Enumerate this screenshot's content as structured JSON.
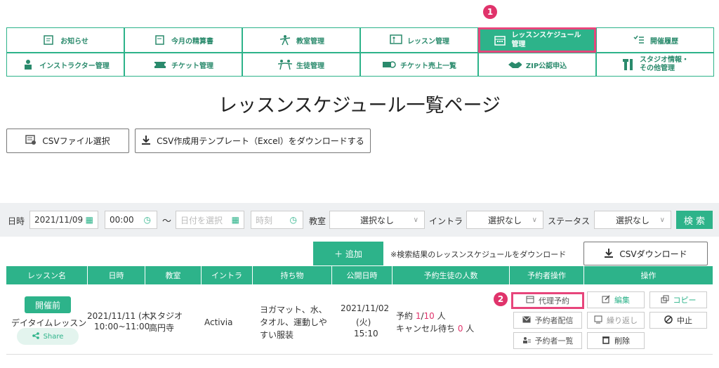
{
  "nav": {
    "row1": [
      {
        "label": "お知らせ",
        "icon": "notice-icon"
      },
      {
        "label": "今月の精算書",
        "icon": "statement-icon"
      },
      {
        "label": "教室管理",
        "icon": "classroom-icon"
      },
      {
        "label": "レッスン管理",
        "icon": "lesson-icon"
      },
      {
        "label": "レッスンスケジュール",
        "label2": "管理",
        "icon": "calendar-icon"
      },
      {
        "label": "開催履歴",
        "icon": "history-icon"
      }
    ],
    "row2": [
      {
        "label": "インストラクター管理",
        "icon": "instructor-icon"
      },
      {
        "label": "チケット管理",
        "icon": "ticket-icon"
      },
      {
        "label": "生徒管理",
        "icon": "students-icon"
      },
      {
        "label": "チケット売上一覧",
        "icon": "ticket-sales-icon"
      },
      {
        "label": "ZIP公認申込",
        "icon": "handshake-icon"
      },
      {
        "label": "スタジオ情報・",
        "label2": "その他管理",
        "icon": "tools-icon"
      }
    ]
  },
  "badges": {
    "b1": "1",
    "b2": "2"
  },
  "page_title": "レッスンスケジュール一覧ページ",
  "csv_select_label": "CSVファイル選択",
  "template_download_label": "CSV作成用テンプレート（Excel）をダウンロードする",
  "filters": {
    "date_label": "日時",
    "date_value": "2021/11/09",
    "time_value": "00:00",
    "tilde": "〜",
    "date_placeholder": "日付を選択",
    "time_placeholder": "時刻",
    "classroom_label": "教室",
    "classroom_value": "選択なし",
    "instructor_label": "イントラ",
    "instructor_value": "選択なし",
    "status_label": "ステータス",
    "status_value": "選択なし",
    "search_label": "検 索"
  },
  "add_label": "＋ 追加",
  "download_note": "※検索結果のレッスンスケジュールをダウンロード",
  "csv_download_label": "CSVダウンロード",
  "table": {
    "headers": [
      "レッスン名",
      "日時",
      "教室",
      "イントラ",
      "持ち物",
      "公開日時",
      "予約生徒の人数",
      "予約者操作",
      "操作"
    ],
    "row": {
      "status": "開催前",
      "name": "デイタイムレッスン",
      "share": "Share",
      "datetime1": "2021/11/11 (木)",
      "datetime2": "10:00~11:00",
      "room1": "スタジオ",
      "room2": "高円寺",
      "instructor": "Activia",
      "items1": "ヨガマット、水、",
      "items2": "タオル、運動しや",
      "items3": "すい服装",
      "pub1": "2021/11/02",
      "pub2": "(火)",
      "pub3": "15:10",
      "reserve_prefix": "予約 ",
      "reserve_count": "1",
      "reserve_sep": "/",
      "reserve_cap": "10",
      "reserve_suffix": " 人",
      "wait_prefix": "キャンセル待ち ",
      "wait_count": "0",
      "wait_suffix": " 人"
    },
    "reserver_ops": [
      "代理予約",
      "予約者配信",
      "予約者一覧"
    ],
    "ops": [
      "編集",
      "コピー",
      "繰り返し",
      "中止",
      "削除"
    ]
  },
  "colors": {
    "accent": "#2db38a",
    "highlight": "#e7457b",
    "red": "#e0336b"
  }
}
